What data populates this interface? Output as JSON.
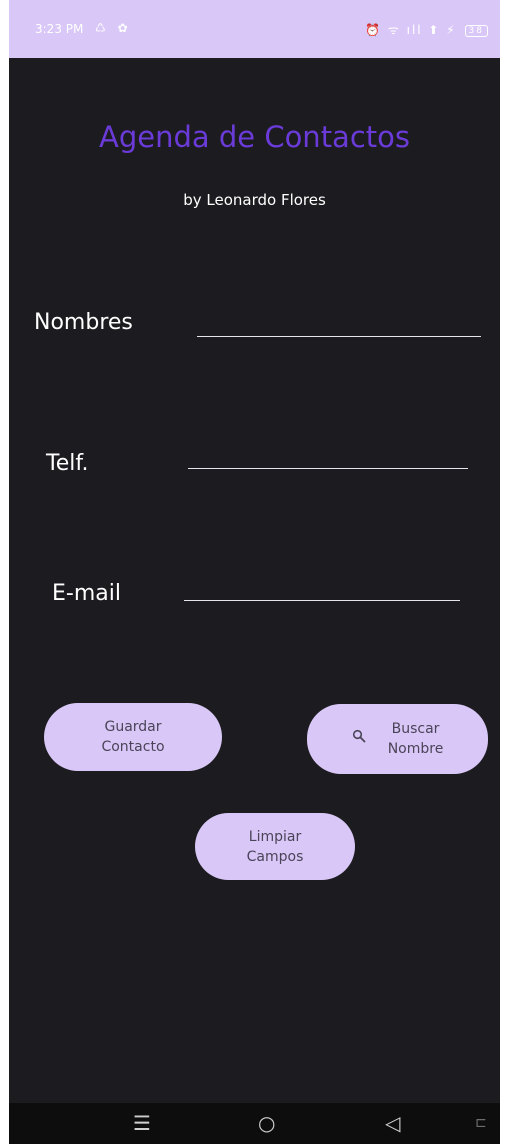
{
  "status_bar": {
    "time": "3:23 PM",
    "left_icons": "♺ ✿",
    "right_icons": "⏰ ᯤ ıll ⬆ ⚡",
    "battery": "38"
  },
  "header": {
    "title": "Agenda de Contactos",
    "subtitle": "by Leonardo Flores"
  },
  "form": {
    "nombres_label": "Nombres",
    "telf_label": "Telf.",
    "email_label": "E-mail",
    "nombres_value": "",
    "telf_value": "",
    "email_value": ""
  },
  "buttons": {
    "guardar_line1": "Guardar",
    "guardar_line2": "Contacto",
    "buscar_line1": "Buscar",
    "buscar_line2": "Nombre",
    "limpiar_line1": "Limpiar",
    "limpiar_line2": "Campos"
  },
  "nav": {
    "menu_icon": "☰",
    "home_icon": "○",
    "back_icon": "◁",
    "rotate_icon": "⊏"
  },
  "colors": {
    "accent": "#6a3bd9",
    "button_bg": "#d9c8f7",
    "background": "#1c1b1f"
  }
}
